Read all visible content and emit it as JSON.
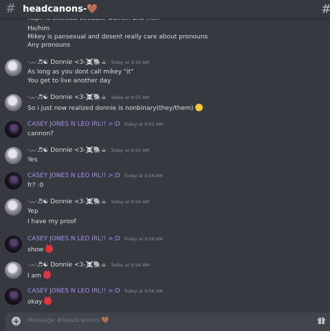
{
  "channel": {
    "hash": "#",
    "name": "headcanons-🤎",
    "right_hash": "#"
  },
  "top_lines": [
    "Raph is bisexual because women and men",
    "He/him",
    "Mikey is pansexual and dosent really care about pronouns",
    "Any pronouns"
  ],
  "messages": [
    {
      "user": "·෴·♬☯ Donnie <3-☠️🐘☕",
      "time": "Today at 9:19 AM",
      "lines": [
        "As long as you dont call mikey \"it\"",
        "You get to live another day"
      ]
    },
    {
      "user": "·෴·♬☯ Donnie <3-☠️🐘☕",
      "time": "Today at 9:55 AM",
      "lines": [
        "So i just now realized donnie is nonbinary(they/them)"
      ]
    },
    {
      "user": "CASEY JONES N LEO IRL!! >:D",
      "time": "Today at 9:55 AM",
      "lines": [
        "cannon?"
      ]
    },
    {
      "user": "·෴·♬☯ Donnie <3-☠️🐘☕",
      "time": "Today at 9:55 AM",
      "lines": [
        "Yes"
      ]
    },
    {
      "user": "CASEY JONES N LEO IRL!! >:D",
      "time": "Today at 9:56 AM",
      "lines": [
        "fr? :0"
      ]
    },
    {
      "user": "·෴·♬☯ Donnie <3-☠️🐘☕",
      "time": "Today at 9:56 AM",
      "lines": [
        "Yep",
        "I have my proof"
      ]
    },
    {
      "user": "CASEY JONES N LEO IRL!! >:D",
      "time": "Today at 9:56 AM",
      "lines": [
        "show"
      ]
    },
    {
      "user": "·෴·♬☯ Donnie <3-☠️🐘☕",
      "time": "Today at 9:56 AM",
      "lines": [
        "I am"
      ]
    },
    {
      "user": "CASEY JONES N LEO IRL!! >:D",
      "time": "Today at 9:56 AM",
      "lines": [
        "okay"
      ]
    }
  ],
  "composer": {
    "placeholder": "Message #headcanons-🤎",
    "plus": "+"
  },
  "icons": [
    "hashtag-icon",
    "plus-icon",
    "gift-icon"
  ]
}
